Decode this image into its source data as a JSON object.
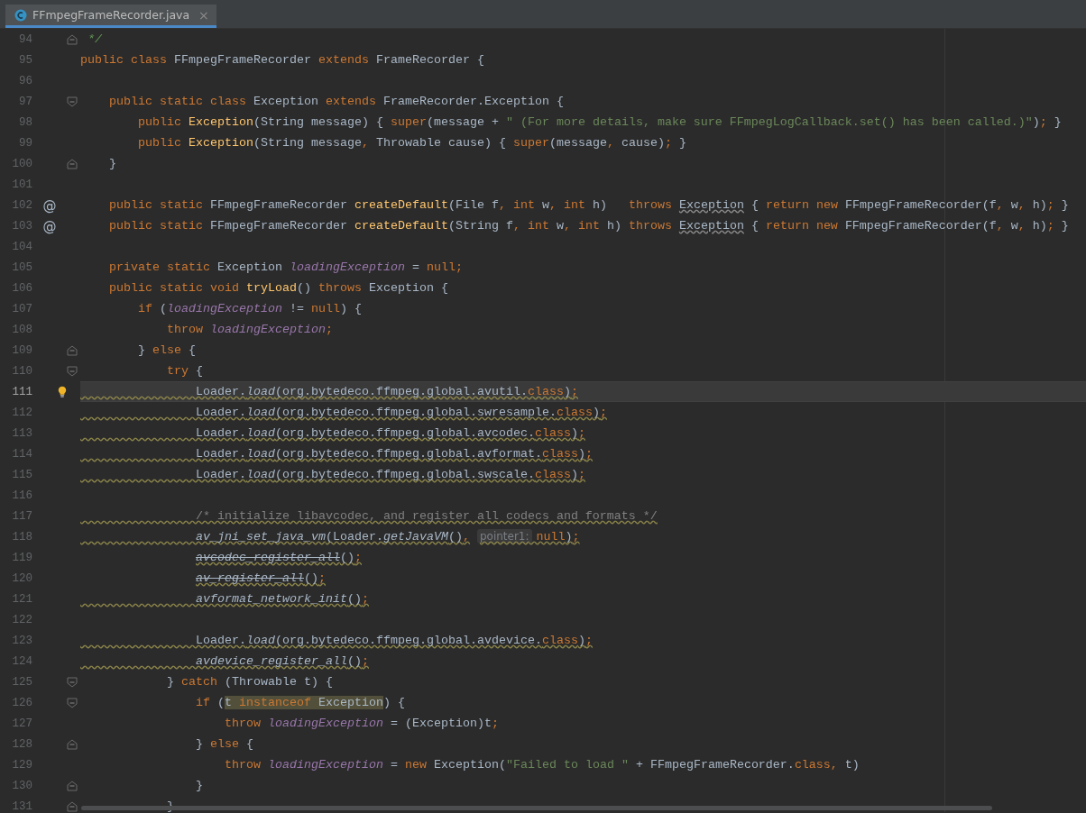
{
  "tab": {
    "title": "FFmpegFrameRecorder.java",
    "selected": true,
    "close": "×"
  },
  "lines": [
    {
      "number": "94",
      "fold": {
        "kind": "end"
      },
      "tokens": [
        {
          "kind": "doc",
          "text": " */"
        }
      ]
    },
    {
      "number": "95",
      "tokens": [
        {
          "kind": "kw",
          "text": "public class "
        },
        {
          "kind": "pl",
          "text": "FFmpegFrameRecorder "
        },
        {
          "kind": "kw",
          "text": "extends "
        },
        {
          "kind": "pl",
          "text": "FrameRecorder {"
        }
      ]
    },
    {
      "number": "96"
    },
    {
      "number": "97",
      "fold": {
        "kind": "start"
      },
      "tokens": [
        {
          "kind": "kw",
          "text": "    public static class "
        },
        {
          "kind": "pl",
          "text": "Exception "
        },
        {
          "kind": "kw",
          "text": "extends "
        },
        {
          "kind": "pl",
          "text": "FrameRecorder.Exception {"
        }
      ]
    },
    {
      "number": "98",
      "tokens": [
        {
          "kind": "kw",
          "text": "        public "
        },
        {
          "kind": "fn",
          "text": "Exception"
        },
        {
          "kind": "pl",
          "text": "(String message) { "
        },
        {
          "kind": "kw",
          "text": "super"
        },
        {
          "kind": "pl",
          "text": "(message + "
        },
        {
          "kind": "str",
          "text": "\" (For more details, make sure FFmpegLogCallback.set() has been called.)\""
        },
        {
          "kind": "pl",
          "text": ")"
        },
        {
          "kind": "kw",
          "text": ";"
        },
        {
          "kind": "pl",
          "text": " }"
        }
      ]
    },
    {
      "number": "99",
      "tokens": [
        {
          "kind": "kw",
          "text": "        public "
        },
        {
          "kind": "fn",
          "text": "Exception"
        },
        {
          "kind": "pl",
          "text": "(String message"
        },
        {
          "kind": "kw",
          "text": ","
        },
        {
          "kind": "pl",
          "text": " Throwable cause) { "
        },
        {
          "kind": "kw",
          "text": "super"
        },
        {
          "kind": "pl",
          "text": "(message"
        },
        {
          "kind": "kw",
          "text": ","
        },
        {
          "kind": "pl",
          "text": " cause)"
        },
        {
          "kind": "kw",
          "text": ";"
        },
        {
          "kind": "pl",
          "text": " }"
        }
      ]
    },
    {
      "number": "100",
      "fold": {
        "kind": "end"
      },
      "tokens": [
        {
          "kind": "pl",
          "text": "    }"
        }
      ]
    },
    {
      "number": "101"
    },
    {
      "number": "102",
      "marker": "@",
      "tokens": [
        {
          "kind": "kw",
          "text": "    public static "
        },
        {
          "kind": "pl",
          "text": "FFmpegFrameRecorder "
        },
        {
          "kind": "fn",
          "text": "createDefault"
        },
        {
          "kind": "pl",
          "text": "(File f"
        },
        {
          "kind": "kw",
          "text": ", int "
        },
        {
          "kind": "pl",
          "text": "w"
        },
        {
          "kind": "kw",
          "text": ", int "
        },
        {
          "kind": "pl",
          "text": "h)   "
        },
        {
          "kind": "kw",
          "text": "throws "
        },
        {
          "kind": "unused",
          "text": "Exception"
        },
        {
          "kind": "pl",
          "text": " { "
        },
        {
          "kind": "kw",
          "text": "return new "
        },
        {
          "kind": "pl",
          "text": "FFmpegFrameRecorder(f"
        },
        {
          "kind": "kw",
          "text": ","
        },
        {
          "kind": "pl",
          "text": " w"
        },
        {
          "kind": "kw",
          "text": ","
        },
        {
          "kind": "pl",
          "text": " h)"
        },
        {
          "kind": "kw",
          "text": ";"
        },
        {
          "kind": "pl",
          "text": " }"
        }
      ]
    },
    {
      "number": "103",
      "marker": "@",
      "tokens": [
        {
          "kind": "kw",
          "text": "    public static "
        },
        {
          "kind": "pl",
          "text": "FFmpegFrameRecorder "
        },
        {
          "kind": "fn",
          "text": "createDefault"
        },
        {
          "kind": "pl",
          "text": "(String f"
        },
        {
          "kind": "kw",
          "text": ", int "
        },
        {
          "kind": "pl",
          "text": "w"
        },
        {
          "kind": "kw",
          "text": ", int "
        },
        {
          "kind": "pl",
          "text": "h) "
        },
        {
          "kind": "kw",
          "text": "throws "
        },
        {
          "kind": "unused",
          "text": "Exception"
        },
        {
          "kind": "pl",
          "text": " { "
        },
        {
          "kind": "kw",
          "text": "return new "
        },
        {
          "kind": "pl",
          "text": "FFmpegFrameRecorder(f"
        },
        {
          "kind": "kw",
          "text": ","
        },
        {
          "kind": "pl",
          "text": " w"
        },
        {
          "kind": "kw",
          "text": ","
        },
        {
          "kind": "pl",
          "text": " h)"
        },
        {
          "kind": "kw",
          "text": ";"
        },
        {
          "kind": "pl",
          "text": " }"
        }
      ]
    },
    {
      "number": "104"
    },
    {
      "number": "105",
      "tokens": [
        {
          "kind": "kw",
          "text": "    private static "
        },
        {
          "kind": "pl",
          "text": "Exception "
        },
        {
          "kind": "sf",
          "text": "loadingException"
        },
        {
          "kind": "pl",
          "text": " = "
        },
        {
          "kind": "kw",
          "text": "null;"
        }
      ]
    },
    {
      "number": "106",
      "tokens": [
        {
          "kind": "kw",
          "text": "    public static void "
        },
        {
          "kind": "fn",
          "text": "tryLoad"
        },
        {
          "kind": "pl",
          "text": "() "
        },
        {
          "kind": "kw",
          "text": "throws "
        },
        {
          "kind": "pl",
          "text": "Exception {"
        }
      ]
    },
    {
      "number": "107",
      "tokens": [
        {
          "kind": "kw",
          "text": "        if "
        },
        {
          "kind": "pl",
          "text": "("
        },
        {
          "kind": "sf",
          "text": "loadingException"
        },
        {
          "kind": "pl",
          "text": " != "
        },
        {
          "kind": "kw",
          "text": "null"
        },
        {
          "kind": "pl",
          "text": ") {"
        }
      ]
    },
    {
      "number": "108",
      "tokens": [
        {
          "kind": "kw",
          "text": "            throw "
        },
        {
          "kind": "sf",
          "text": "loadingException"
        },
        {
          "kind": "kw",
          "text": ";"
        }
      ]
    },
    {
      "number": "109",
      "fold": {
        "kind": "end"
      },
      "tokens": [
        {
          "kind": "pl",
          "text": "        } "
        },
        {
          "kind": "kw",
          "text": "else "
        },
        {
          "kind": "pl",
          "text": "{"
        }
      ]
    },
    {
      "number": "110",
      "fold": {
        "kind": "start"
      },
      "tokens": [
        {
          "kind": "kw",
          "text": "            try "
        },
        {
          "kind": "pl",
          "text": "{"
        }
      ]
    },
    {
      "number": "111",
      "current": true,
      "bulb": true,
      "warning": true,
      "tokens": [
        {
          "kind": "pl",
          "text": "                Loader."
        },
        {
          "kind": "sm",
          "text": "load"
        },
        {
          "kind": "pl",
          "text": "(org.bytedeco.ffmpeg.global.avutil."
        },
        {
          "kind": "kw",
          "text": "class"
        },
        {
          "kind": "pl",
          "text": ")"
        },
        {
          "kind": "kw",
          "text": ";"
        }
      ]
    },
    {
      "number": "112",
      "warning": true,
      "tokens": [
        {
          "kind": "pl",
          "text": "                Loader."
        },
        {
          "kind": "sm",
          "text": "load"
        },
        {
          "kind": "pl",
          "text": "(org.bytedeco.ffmpeg.global.swresample."
        },
        {
          "kind": "kw",
          "text": "class"
        },
        {
          "kind": "pl",
          "text": ")"
        },
        {
          "kind": "kw",
          "text": ";"
        }
      ]
    },
    {
      "number": "113",
      "warning": true,
      "tokens": [
        {
          "kind": "pl",
          "text": "                Loader."
        },
        {
          "kind": "sm",
          "text": "load"
        },
        {
          "kind": "pl",
          "text": "(org.bytedeco.ffmpeg.global.avcodec."
        },
        {
          "kind": "kw",
          "text": "class"
        },
        {
          "kind": "pl",
          "text": ")"
        },
        {
          "kind": "kw",
          "text": ";"
        }
      ]
    },
    {
      "number": "114",
      "warning": true,
      "tokens": [
        {
          "kind": "pl",
          "text": "                Loader."
        },
        {
          "kind": "sm",
          "text": "load"
        },
        {
          "kind": "pl",
          "text": "(org.bytedeco.ffmpeg.global.avformat."
        },
        {
          "kind": "kw",
          "text": "class"
        },
        {
          "kind": "pl",
          "text": ")"
        },
        {
          "kind": "kw",
          "text": ";"
        }
      ]
    },
    {
      "number": "115",
      "warning": true,
      "tokens": [
        {
          "kind": "pl",
          "text": "                Loader."
        },
        {
          "kind": "sm",
          "text": "load"
        },
        {
          "kind": "pl",
          "text": "(org.bytedeco.ffmpeg.global.swscale."
        },
        {
          "kind": "kw",
          "text": "class"
        },
        {
          "kind": "pl",
          "text": ")"
        },
        {
          "kind": "kw",
          "text": ";"
        }
      ]
    },
    {
      "number": "116"
    },
    {
      "number": "117",
      "warning": true,
      "tokens": [
        {
          "kind": "cm",
          "text": "                /* initialize libavcodec, and register all codecs and formats */"
        }
      ]
    },
    {
      "number": "118",
      "warning": true,
      "tokens": [
        {
          "kind": "sm",
          "text": "                av_jni_set_java_vm"
        },
        {
          "kind": "pl",
          "text": "(Loader."
        },
        {
          "kind": "sm",
          "text": "getJavaVM"
        },
        {
          "kind": "pl",
          "text": "()"
        },
        {
          "kind": "kw",
          "text": ","
        },
        {
          "kind": "hint",
          "text": "pointer1:"
        },
        {
          "kind": "kw",
          "text": " null"
        },
        {
          "kind": "pl",
          "text": ")"
        },
        {
          "kind": "kw",
          "text": ";"
        }
      ]
    },
    {
      "number": "119",
      "warning": true,
      "tokens": [
        {
          "kind": "dep",
          "text": "avcodec_register_all"
        },
        {
          "kind": "pl",
          "text": "()"
        },
        {
          "kind": "kw",
          "text": ";"
        }
      ]
    },
    {
      "number": "120",
      "warning": true,
      "tokens": [
        {
          "kind": "dep",
          "text": "av_register_all"
        },
        {
          "kind": "pl",
          "text": "()"
        },
        {
          "kind": "kw",
          "text": ";"
        }
      ]
    },
    {
      "number": "121",
      "warning": true,
      "tokens": [
        {
          "kind": "sm",
          "text": "                avformat_network_init"
        },
        {
          "kind": "pl",
          "text": "()"
        },
        {
          "kind": "kw",
          "text": ";"
        }
      ]
    },
    {
      "number": "122"
    },
    {
      "number": "123",
      "warning": true,
      "tokens": [
        {
          "kind": "pl",
          "text": "                Loader."
        },
        {
          "kind": "sm",
          "text": "load"
        },
        {
          "kind": "pl",
          "text": "(org.bytedeco.ffmpeg.global.avdevice."
        },
        {
          "kind": "kw",
          "text": "class"
        },
        {
          "kind": "pl",
          "text": ")"
        },
        {
          "kind": "kw",
          "text": ";"
        }
      ]
    },
    {
      "number": "124",
      "warning": true,
      "tokens": [
        {
          "kind": "sm",
          "text": "                avdevice_register_all"
        },
        {
          "kind": "pl",
          "text": "()"
        },
        {
          "kind": "kw",
          "text": ";"
        }
      ]
    },
    {
      "number": "125",
      "fold": {
        "kind": "start"
      },
      "tokens": [
        {
          "kind": "pl",
          "text": "            } "
        },
        {
          "kind": "kw",
          "text": "catch "
        },
        {
          "kind": "pl",
          "text": "(Throwable t) {"
        }
      ]
    },
    {
      "number": "126",
      "fold": {
        "kind": "start"
      },
      "tokens": [
        {
          "kind": "kw",
          "text": "                if "
        },
        {
          "kind": "pl",
          "text": "("
        },
        {
          "kind": "hlpl",
          "text": "t "
        },
        {
          "kind": "hlkw",
          "text": "instanceof"
        },
        {
          "kind": "hlpl",
          "text": " Exception"
        },
        {
          "kind": "pl",
          "text": ") {"
        }
      ]
    },
    {
      "number": "127",
      "tokens": [
        {
          "kind": "kw",
          "text": "                    throw "
        },
        {
          "kind": "sf",
          "text": "loadingException"
        },
        {
          "kind": "pl",
          "text": " = (Exception)t"
        },
        {
          "kind": "kw",
          "text": ";"
        }
      ]
    },
    {
      "number": "128",
      "fold": {
        "kind": "end"
      },
      "tokens": [
        {
          "kind": "pl",
          "text": "                } "
        },
        {
          "kind": "kw",
          "text": "else "
        },
        {
          "kind": "pl",
          "text": "{"
        }
      ]
    },
    {
      "number": "129",
      "tokens": [
        {
          "kind": "kw",
          "text": "                    throw "
        },
        {
          "kind": "sf",
          "text": "loadingException"
        },
        {
          "kind": "pl",
          "text": " = "
        },
        {
          "kind": "kw",
          "text": "new "
        },
        {
          "kind": "pl",
          "text": "Exception("
        },
        {
          "kind": "str",
          "text": "\"Failed to load \""
        },
        {
          "kind": "pl",
          "text": " + FFmpegFrameRecorder."
        },
        {
          "kind": "kw",
          "text": "class,"
        },
        {
          "kind": "pl",
          "text": " t)"
        }
      ]
    },
    {
      "number": "130",
      "fold": {
        "kind": "end"
      },
      "tokens": [
        {
          "kind": "pl",
          "text": "                }"
        }
      ]
    },
    {
      "number": "131",
      "fold": {
        "kind": "end"
      },
      "tokens": [
        {
          "kind": "pl",
          "text": "            }"
        }
      ]
    }
  ]
}
